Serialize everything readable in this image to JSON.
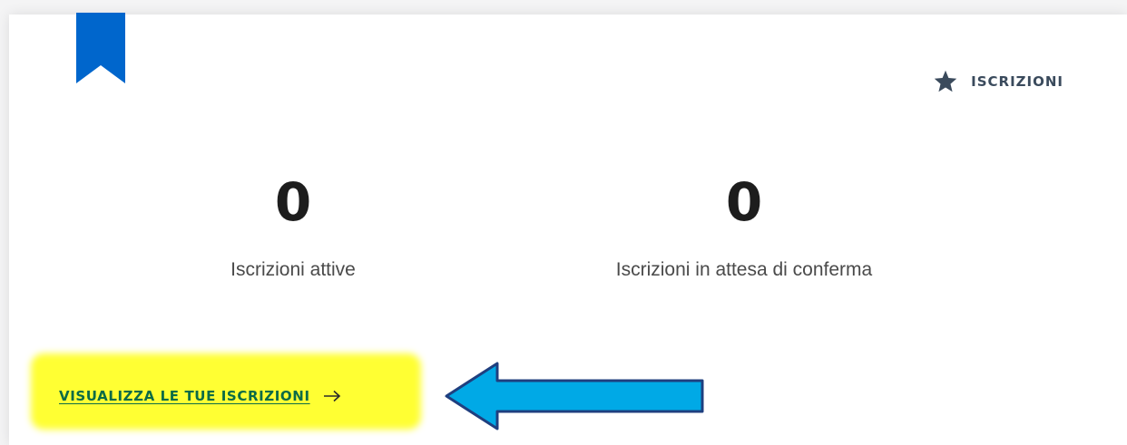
{
  "header": {
    "icon": "star-icon",
    "label": "ISCRIZIONI"
  },
  "bookmark": {
    "icon": "bookmark-icon",
    "color": "#0066cc"
  },
  "stats": [
    {
      "value": "0",
      "label": "Iscrizioni attive"
    },
    {
      "value": "0",
      "label": "Iscrizioni in attesa di conferma"
    }
  ],
  "cta": {
    "label": "VISUALIZZA LE TUE ISCRIZIONI",
    "icon": "arrow-right-icon",
    "color": "#0b6b46"
  },
  "annotation": {
    "highlight_color": "#ffff33",
    "arrow_color": "#00a9e6",
    "arrow_outline": "#1f3f7f"
  }
}
